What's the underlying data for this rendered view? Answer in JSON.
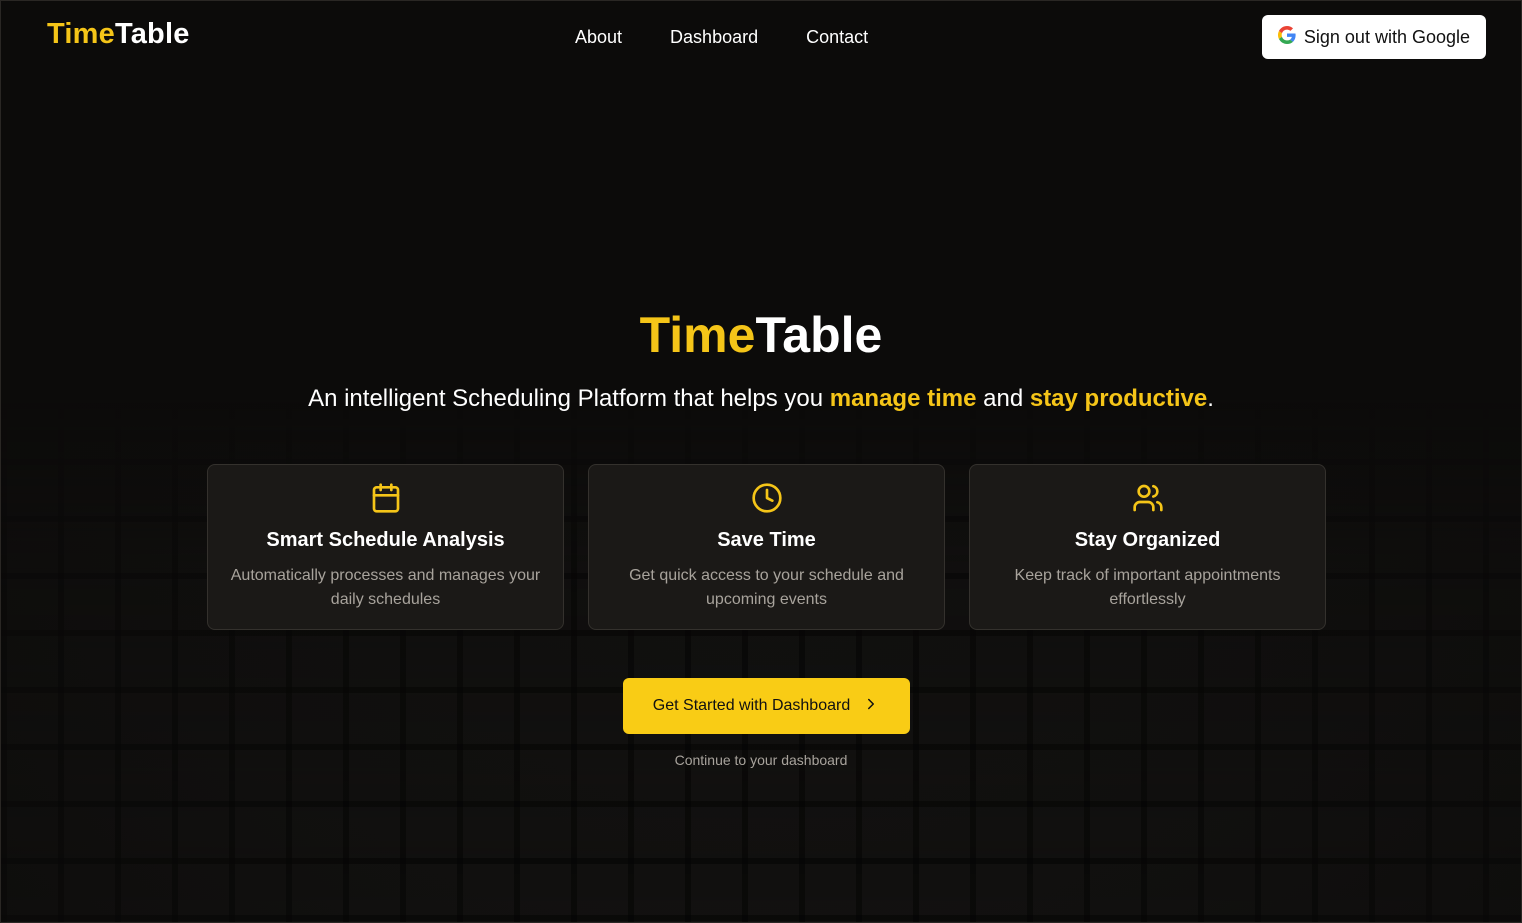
{
  "header": {
    "logo": {
      "part1": "Time",
      "part2": "Table"
    },
    "nav": [
      {
        "label": "About"
      },
      {
        "label": "Dashboard"
      },
      {
        "label": "Contact"
      }
    ],
    "signout_label": "Sign out with Google",
    "signout_icon": "google-icon"
  },
  "hero": {
    "title_part1": "Time",
    "title_part2": "Table",
    "tagline": {
      "prefix": "An intelligent Scheduling Platform that helps you ",
      "highlight1": "manage time",
      "middle": " and ",
      "highlight2": "stay productive",
      "suffix": "."
    }
  },
  "features": [
    {
      "icon": "calendar-icon",
      "title": "Smart Schedule Analysis",
      "description": "Automatically processes and manages your daily schedules"
    },
    {
      "icon": "clock-icon",
      "title": "Save Time",
      "description": "Get quick access to your schedule and upcoming events"
    },
    {
      "icon": "users-icon",
      "title": "Stay Organized",
      "description": "Keep track of important appointments effortlessly"
    }
  ],
  "cta": {
    "label": "Get Started with Dashboard",
    "icon": "chevron-right-icon",
    "subtext": "Continue to your dashboard"
  },
  "colors": {
    "accent": "#f5c518",
    "button": "#f9cc15",
    "background": "#0c0b0a",
    "card": "#1b1917"
  }
}
